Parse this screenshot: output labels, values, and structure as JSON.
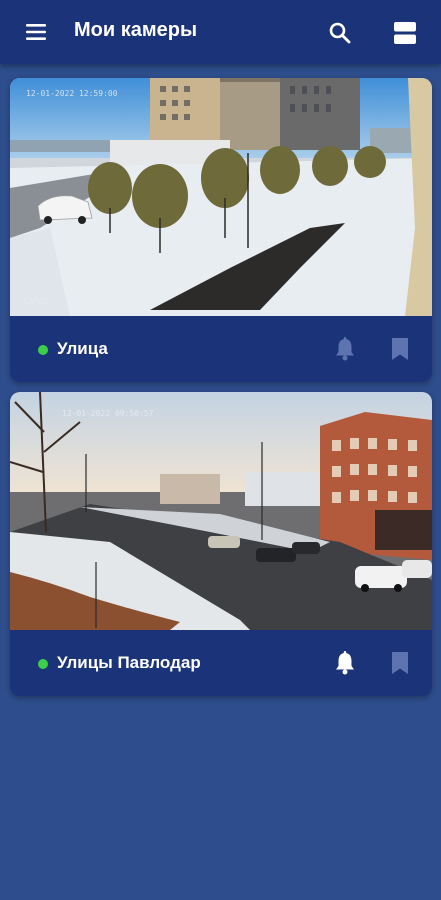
{
  "appbar": {
    "title": "Мои камеры",
    "menu_icon": "menu-icon",
    "search_icon": "search-icon",
    "layout_icon": "layout-toggle-icon"
  },
  "cameras": [
    {
      "name": "Улица",
      "status": "online",
      "status_color": "#3ecf4a",
      "overlay_timestamp": "12-01-2022 12:59:00",
      "overlay_label": "CAM01",
      "notifications": "off",
      "bookmarked": false
    },
    {
      "name": "Улицы Павлодар",
      "status": "online",
      "status_color": "#3ecf4a",
      "overlay_timestamp": "12-01-2022 09:50:57",
      "notifications": "on",
      "bookmarked": false
    }
  ],
  "colors": {
    "background": "#2e4d8c",
    "appbar": "#1b3378",
    "card": "#1b3378",
    "status_online": "#3ecf4a",
    "icon_active": "#ffffff",
    "icon_inactive": "#5d74b0"
  }
}
